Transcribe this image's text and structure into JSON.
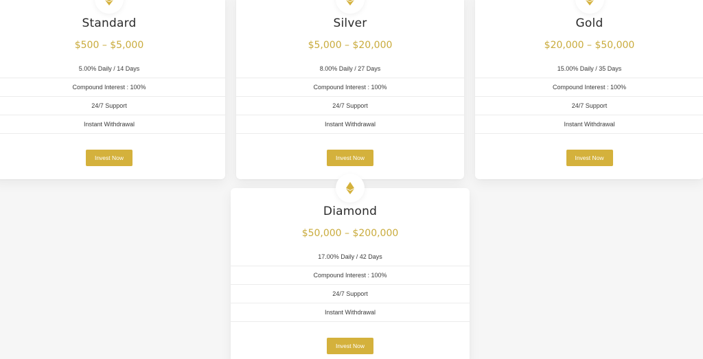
{
  "colors": {
    "accent": "#d4b13c",
    "price_text": "#c9ab3c",
    "card_bg": "#ffffff",
    "page_bg": "#f6f6f6"
  },
  "plans": [
    {
      "icon": "ethereum-icon",
      "name": "Standard",
      "price": "$500 – $5,000",
      "features": [
        "5.00% Daily / 14 Days",
        "Compound Interest : 100%",
        "24/7 Support",
        "Instant Withdrawal"
      ],
      "button": "Invest Now"
    },
    {
      "icon": "ethereum-icon",
      "name": "Silver",
      "price": "$5,000 – $20,000",
      "features": [
        "8.00% Daily / 27 Days",
        "Compound Interest : 100%",
        "24/7 Support",
        "Instant Withdrawal"
      ],
      "button": "Invest Now"
    },
    {
      "icon": "ethereum-icon",
      "name": "Gold",
      "price": "$20,000 – $50,000",
      "features": [
        "15.00% Daily / 35 Days",
        "Compound Interest : 100%",
        "24/7 Support",
        "Instant Withdrawal"
      ],
      "button": "Invest Now"
    },
    {
      "icon": "ethereum-icon",
      "name": "Diamond",
      "price": "$50,000 – $200,000",
      "features": [
        "17.00% Daily / 42 Days",
        "Compound Interest : 100%",
        "24/7 Support",
        "Instant Withdrawal"
      ],
      "button": "Invest Now"
    }
  ]
}
